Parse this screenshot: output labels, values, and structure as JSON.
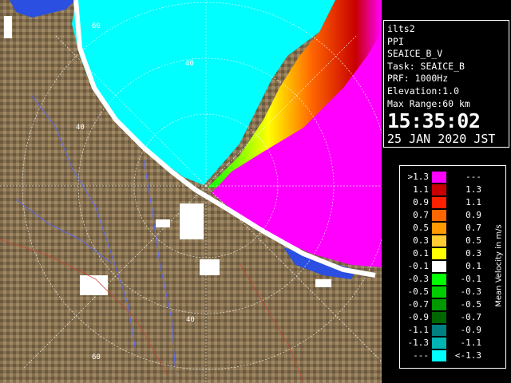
{
  "radar_info": {
    "site": "ilts2",
    "product": "PPI",
    "field": "SEAICE_B_V",
    "task": "Task: SEAICE_B",
    "prf": "PRF: 1000Hz",
    "elevation": "Elevation:1.0",
    "max_range": "Max Range:60 km",
    "time": "15:35:02",
    "date": "25 JAN 2020 JST"
  },
  "range_labels": [
    "60",
    "40",
    "40",
    "40",
    "60"
  ],
  "colors": {
    "sea_low": "#00ffff",
    "velocity_high": "#ff00ff",
    "land": "#86704f",
    "coast_white": "#ffffff",
    "water_blue": "#2b4fe0"
  },
  "legend": {
    "title": "Mean Velocity in m/s",
    "rows": [
      {
        "low": ">1.3",
        "high": "---",
        "color": "#ff00ff"
      },
      {
        "low": "1.1",
        "high": "1.3",
        "color": "#c80000"
      },
      {
        "low": "0.9",
        "high": "1.1",
        "color": "#ff2000"
      },
      {
        "low": "0.7",
        "high": "0.9",
        "color": "#ff6600"
      },
      {
        "low": "0.5",
        "high": "0.7",
        "color": "#ff9a00"
      },
      {
        "low": "0.3",
        "high": "0.5",
        "color": "#ffcc33"
      },
      {
        "low": "0.1",
        "high": "0.3",
        "color": "#ffff00"
      },
      {
        "low": "-0.1",
        "high": "0.1",
        "color": "#ffffff"
      },
      {
        "low": "-0.3",
        "high": "-0.1",
        "color": "#00ff00"
      },
      {
        "low": "-0.5",
        "high": "-0.3",
        "color": "#00cc00"
      },
      {
        "low": "-0.7",
        "high": "-0.5",
        "color": "#009900"
      },
      {
        "low": "-0.9",
        "high": "-0.7",
        "color": "#006600"
      },
      {
        "low": "-1.1",
        "high": "-0.9",
        "color": "#008080"
      },
      {
        "low": "-1.3",
        "high": "-1.1",
        "color": "#00b4b4"
      },
      {
        "low": "---",
        "high": "<-1.3",
        "color": "#00ffff"
      }
    ]
  }
}
